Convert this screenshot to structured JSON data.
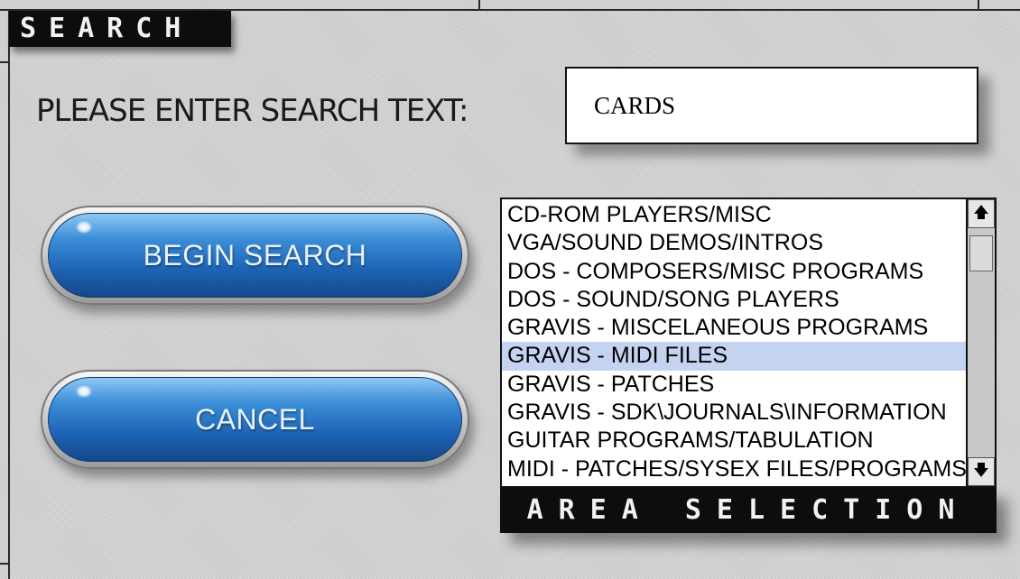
{
  "dialog": {
    "title": "SEARCH"
  },
  "search": {
    "prompt": "PLEASE ENTER SEARCH TEXT:",
    "value": "CARDS"
  },
  "buttons": {
    "begin_search": "BEGIN SEARCH",
    "cancel": "CANCEL"
  },
  "area_list": {
    "items": [
      "CD-ROM PLAYERS/MISC",
      "VGA/SOUND DEMOS/INTROS",
      "DOS - COMPOSERS/MISC PROGRAMS",
      "DOS - SOUND/SONG PLAYERS",
      "GRAVIS - MISCELANEOUS PROGRAMS",
      "GRAVIS - MIDI FILES",
      "GRAVIS - PATCHES",
      "GRAVIS - SDK\\JOURNALS\\INFORMATION",
      "GUITAR PROGRAMS/TABULATION",
      "MIDI - PATCHES/SYSEX FILES/PROGRAMS"
    ],
    "selected_item": "GRAVIS - MIDI FILES",
    "label": "AREA SELECTION",
    "scroll_up_icon": "arrow-up-icon",
    "scroll_down_icon": "arrow-down-icon"
  },
  "colors": {
    "button_blue": "#1d63b4",
    "selection": "#c4d4f0",
    "label_bg": "#0d0d0d"
  }
}
